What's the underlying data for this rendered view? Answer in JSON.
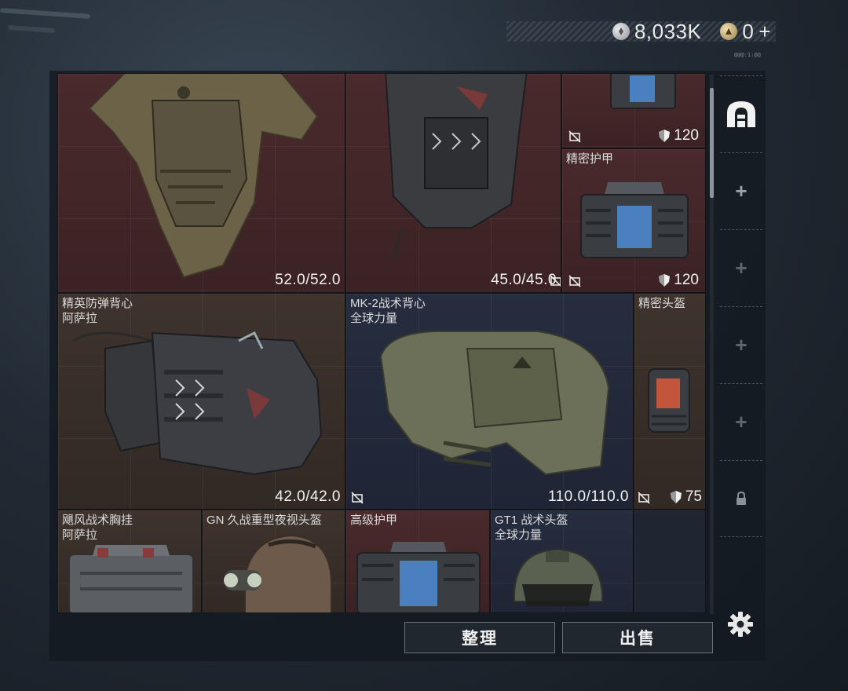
{
  "currency": {
    "silver_amount": "8,033K",
    "gold_amount": "0",
    "gold_add": "+",
    "note": "@@@:1:@@"
  },
  "items": {
    "vest_top_left": {
      "durability": "52.0/52.0"
    },
    "vest_top_mid": {
      "durability": "45.0/45.0"
    },
    "armor_top_right": {
      "armor": "120"
    },
    "precision_armor": {
      "name": "精密护甲",
      "armor": "120"
    },
    "elite_vest": {
      "name": "精英防弹背心",
      "brand": "阿萨拉",
      "durability": "42.0/42.0"
    },
    "mk2_vest": {
      "name": "MK-2战术背心",
      "brand": "全球力量",
      "durability": "110.0/110.0"
    },
    "precision_helmet": {
      "name": "精密头盔",
      "armor": "75"
    },
    "typhoon_rig": {
      "name": "飓风战术胸挂",
      "brand": "阿萨拉"
    },
    "gn_helmet": {
      "name": "GN 久战重型夜视头盔"
    },
    "advanced_armor": {
      "name": "高级护甲"
    },
    "gt1_helmet": {
      "name": "GT1 战术头盔",
      "brand": "全球力量"
    }
  },
  "sidebar": {
    "slots": [
      "+",
      "+",
      "+",
      "+"
    ]
  },
  "buttons": {
    "organize": "整理",
    "sell": "出售"
  },
  "icons": [
    "silver-coin-icon",
    "gold-coin-icon",
    "shield-icon",
    "no-sell-icon",
    "armor-category-icon",
    "lock-icon",
    "gear-icon"
  ]
}
